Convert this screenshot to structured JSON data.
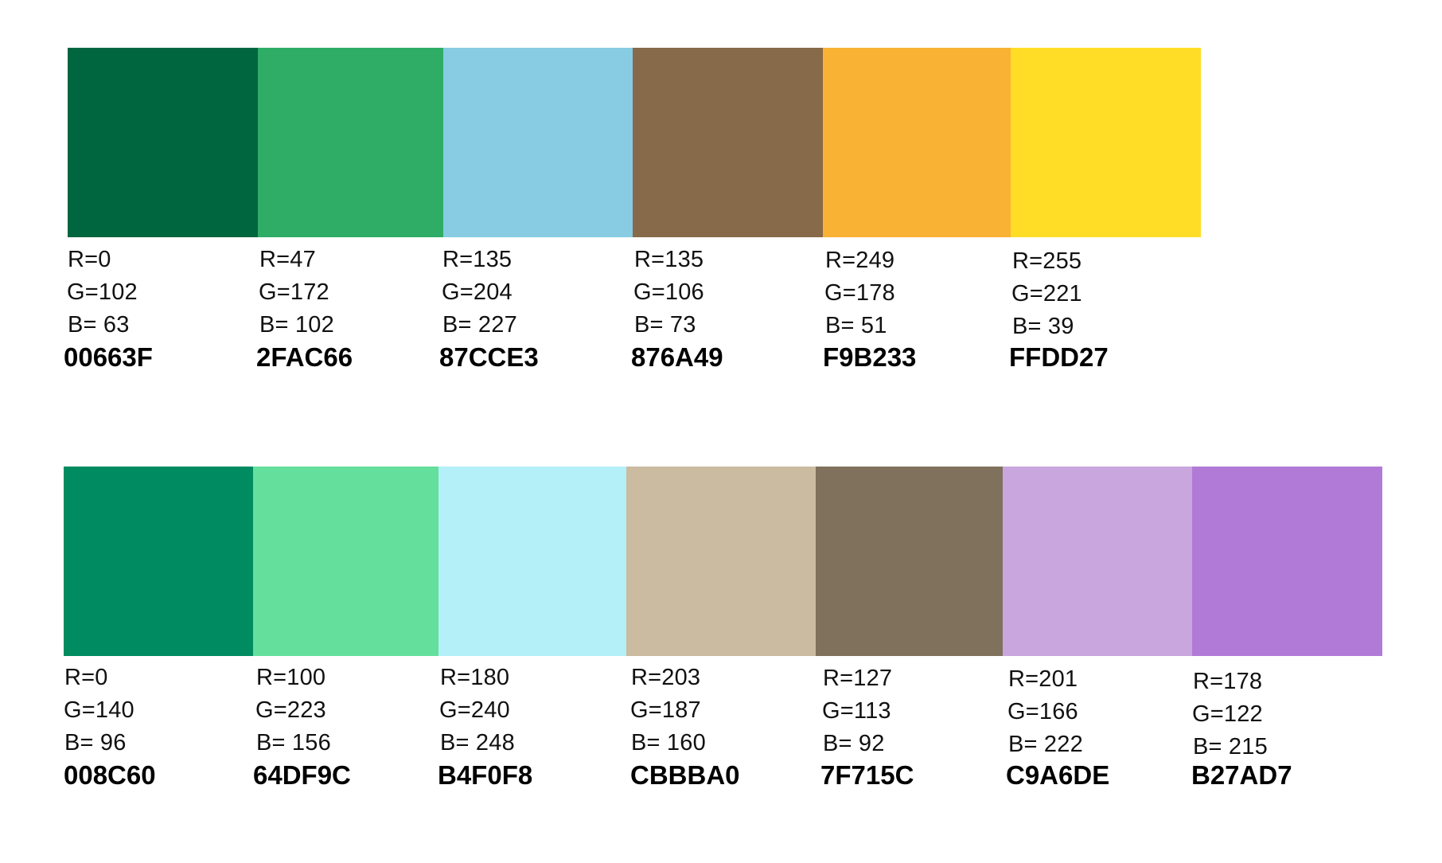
{
  "palettes": [
    {
      "swatches": [
        {
          "color": "#00663F",
          "r": "R=0",
          "g": "G=102",
          "b": "B= 63",
          "hex": "00663F"
        },
        {
          "color": "#2FAC66",
          "r": "R=47",
          "g": "G=172",
          "b": "B= 102",
          "hex": "2FAC66"
        },
        {
          "color": "#87CCE3",
          "r": "R=135",
          "g": "G=204",
          "b": "B= 227",
          "hex": "87CCE3"
        },
        {
          "color": "#876A49",
          "r": "R=135",
          "g": "G=106",
          "b": "B= 73",
          "hex": "876A49"
        },
        {
          "color": "#F9B233",
          "r": "R=249",
          "g": "G=178",
          "b": "B= 51",
          "hex": "F9B233"
        },
        {
          "color": "#FFDD27",
          "r": "R=255",
          "g": "G=221",
          "b": "B= 39",
          "hex": "FFDD27"
        }
      ]
    },
    {
      "swatches": [
        {
          "color": "#008C60",
          "r": "R=0",
          "g": "G=140",
          "b": "B= 96",
          "hex": "008C60"
        },
        {
          "color": "#64DF9C",
          "r": "R=100",
          "g": "G=223",
          "b": "B= 156",
          "hex": "64DF9C"
        },
        {
          "color": "#B4F0F8",
          "r": "R=180",
          "g": "G=240",
          "b": "B= 248",
          "hex": "B4F0F8"
        },
        {
          "color": "#CBBBA0",
          "r": "R=203",
          "g": "G=187",
          "b": "B= 160",
          "hex": "CBBBA0"
        },
        {
          "color": "#7F715C",
          "r": "R=127",
          "g": "G=113",
          "b": "B= 92",
          "hex": "7F715C"
        },
        {
          "color": "#C9A6DE",
          "r": "R=201",
          "g": "G=166",
          "b": "B= 222",
          "hex": "C9A6DE"
        },
        {
          "color": "#B27AD7",
          "r": "R=178",
          "g": "G=122",
          "b": "B= 215",
          "hex": "B27AD7"
        }
      ]
    }
  ]
}
